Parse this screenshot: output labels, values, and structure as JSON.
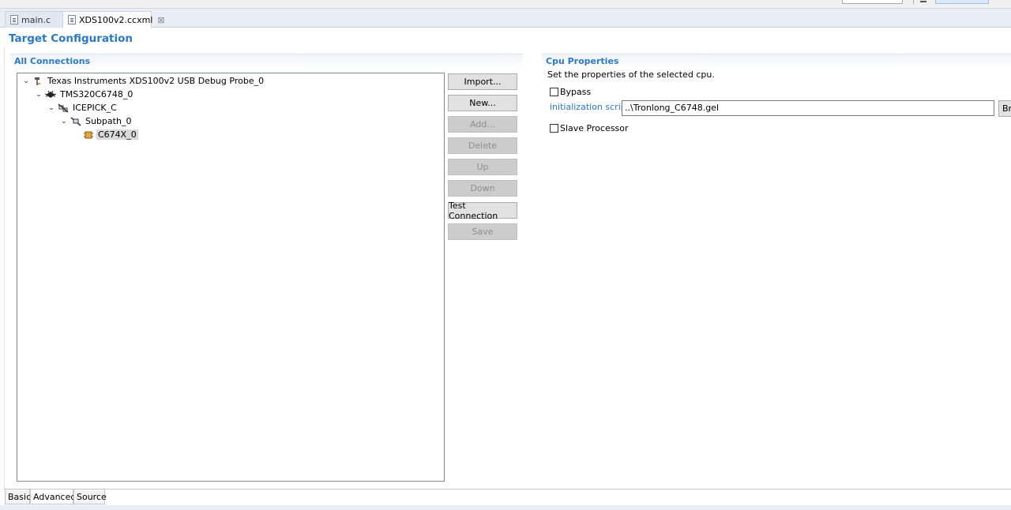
{
  "editor_tabs": [
    {
      "label": "main.c",
      "active": false
    },
    {
      "label": "XDS100v2.ccxml",
      "active": true,
      "close": "⊠"
    }
  ],
  "page_title": "Target Configuration",
  "all_connections": {
    "header": "All Connections",
    "tree": [
      {
        "label": "Texas Instruments XDS100v2 USB Debug Probe_0",
        "depth": 0,
        "expanded": true,
        "icon": "debug-probe-icon"
      },
      {
        "label": "TMS320C6748_0",
        "depth": 1,
        "expanded": true,
        "icon": "chip-icon"
      },
      {
        "label": "ICEPICK_C",
        "depth": 2,
        "expanded": true,
        "icon": "router-icon"
      },
      {
        "label": "Subpath_0",
        "depth": 3,
        "expanded": true,
        "icon": "subpath-icon"
      },
      {
        "label": "C674X_0",
        "depth": 4,
        "expanded": null,
        "icon": "cpu-icon",
        "selected": true
      }
    ],
    "buttons": [
      {
        "label": "Import...",
        "enabled": true
      },
      {
        "label": "New...",
        "enabled": true
      },
      {
        "label": "Add...",
        "enabled": false
      },
      {
        "label": "Delete",
        "enabled": false
      },
      {
        "label": "Up",
        "enabled": false
      },
      {
        "label": "Down",
        "enabled": false
      },
      {
        "label": "Test Connection",
        "enabled": true
      },
      {
        "label": "Save",
        "enabled": false
      }
    ]
  },
  "cpu_properties": {
    "header": "Cpu Properties",
    "description": "Set the properties of the selected cpu.",
    "bypass_label": "Bypass",
    "bypass_checked": false,
    "init_script_label": "initialization script",
    "init_script_value": "..\\Tronlong_C6748.gel",
    "browse_label": "Browse...",
    "slave_processor_label": "Slave Processor",
    "slave_processor_checked": false
  },
  "bottom_tabs": [
    "Basic",
    "Advanced",
    "Source"
  ],
  "colors": {
    "accent": "#2a78c9",
    "disabled_button": "#cccccc",
    "selection": "#d9d9d9"
  }
}
